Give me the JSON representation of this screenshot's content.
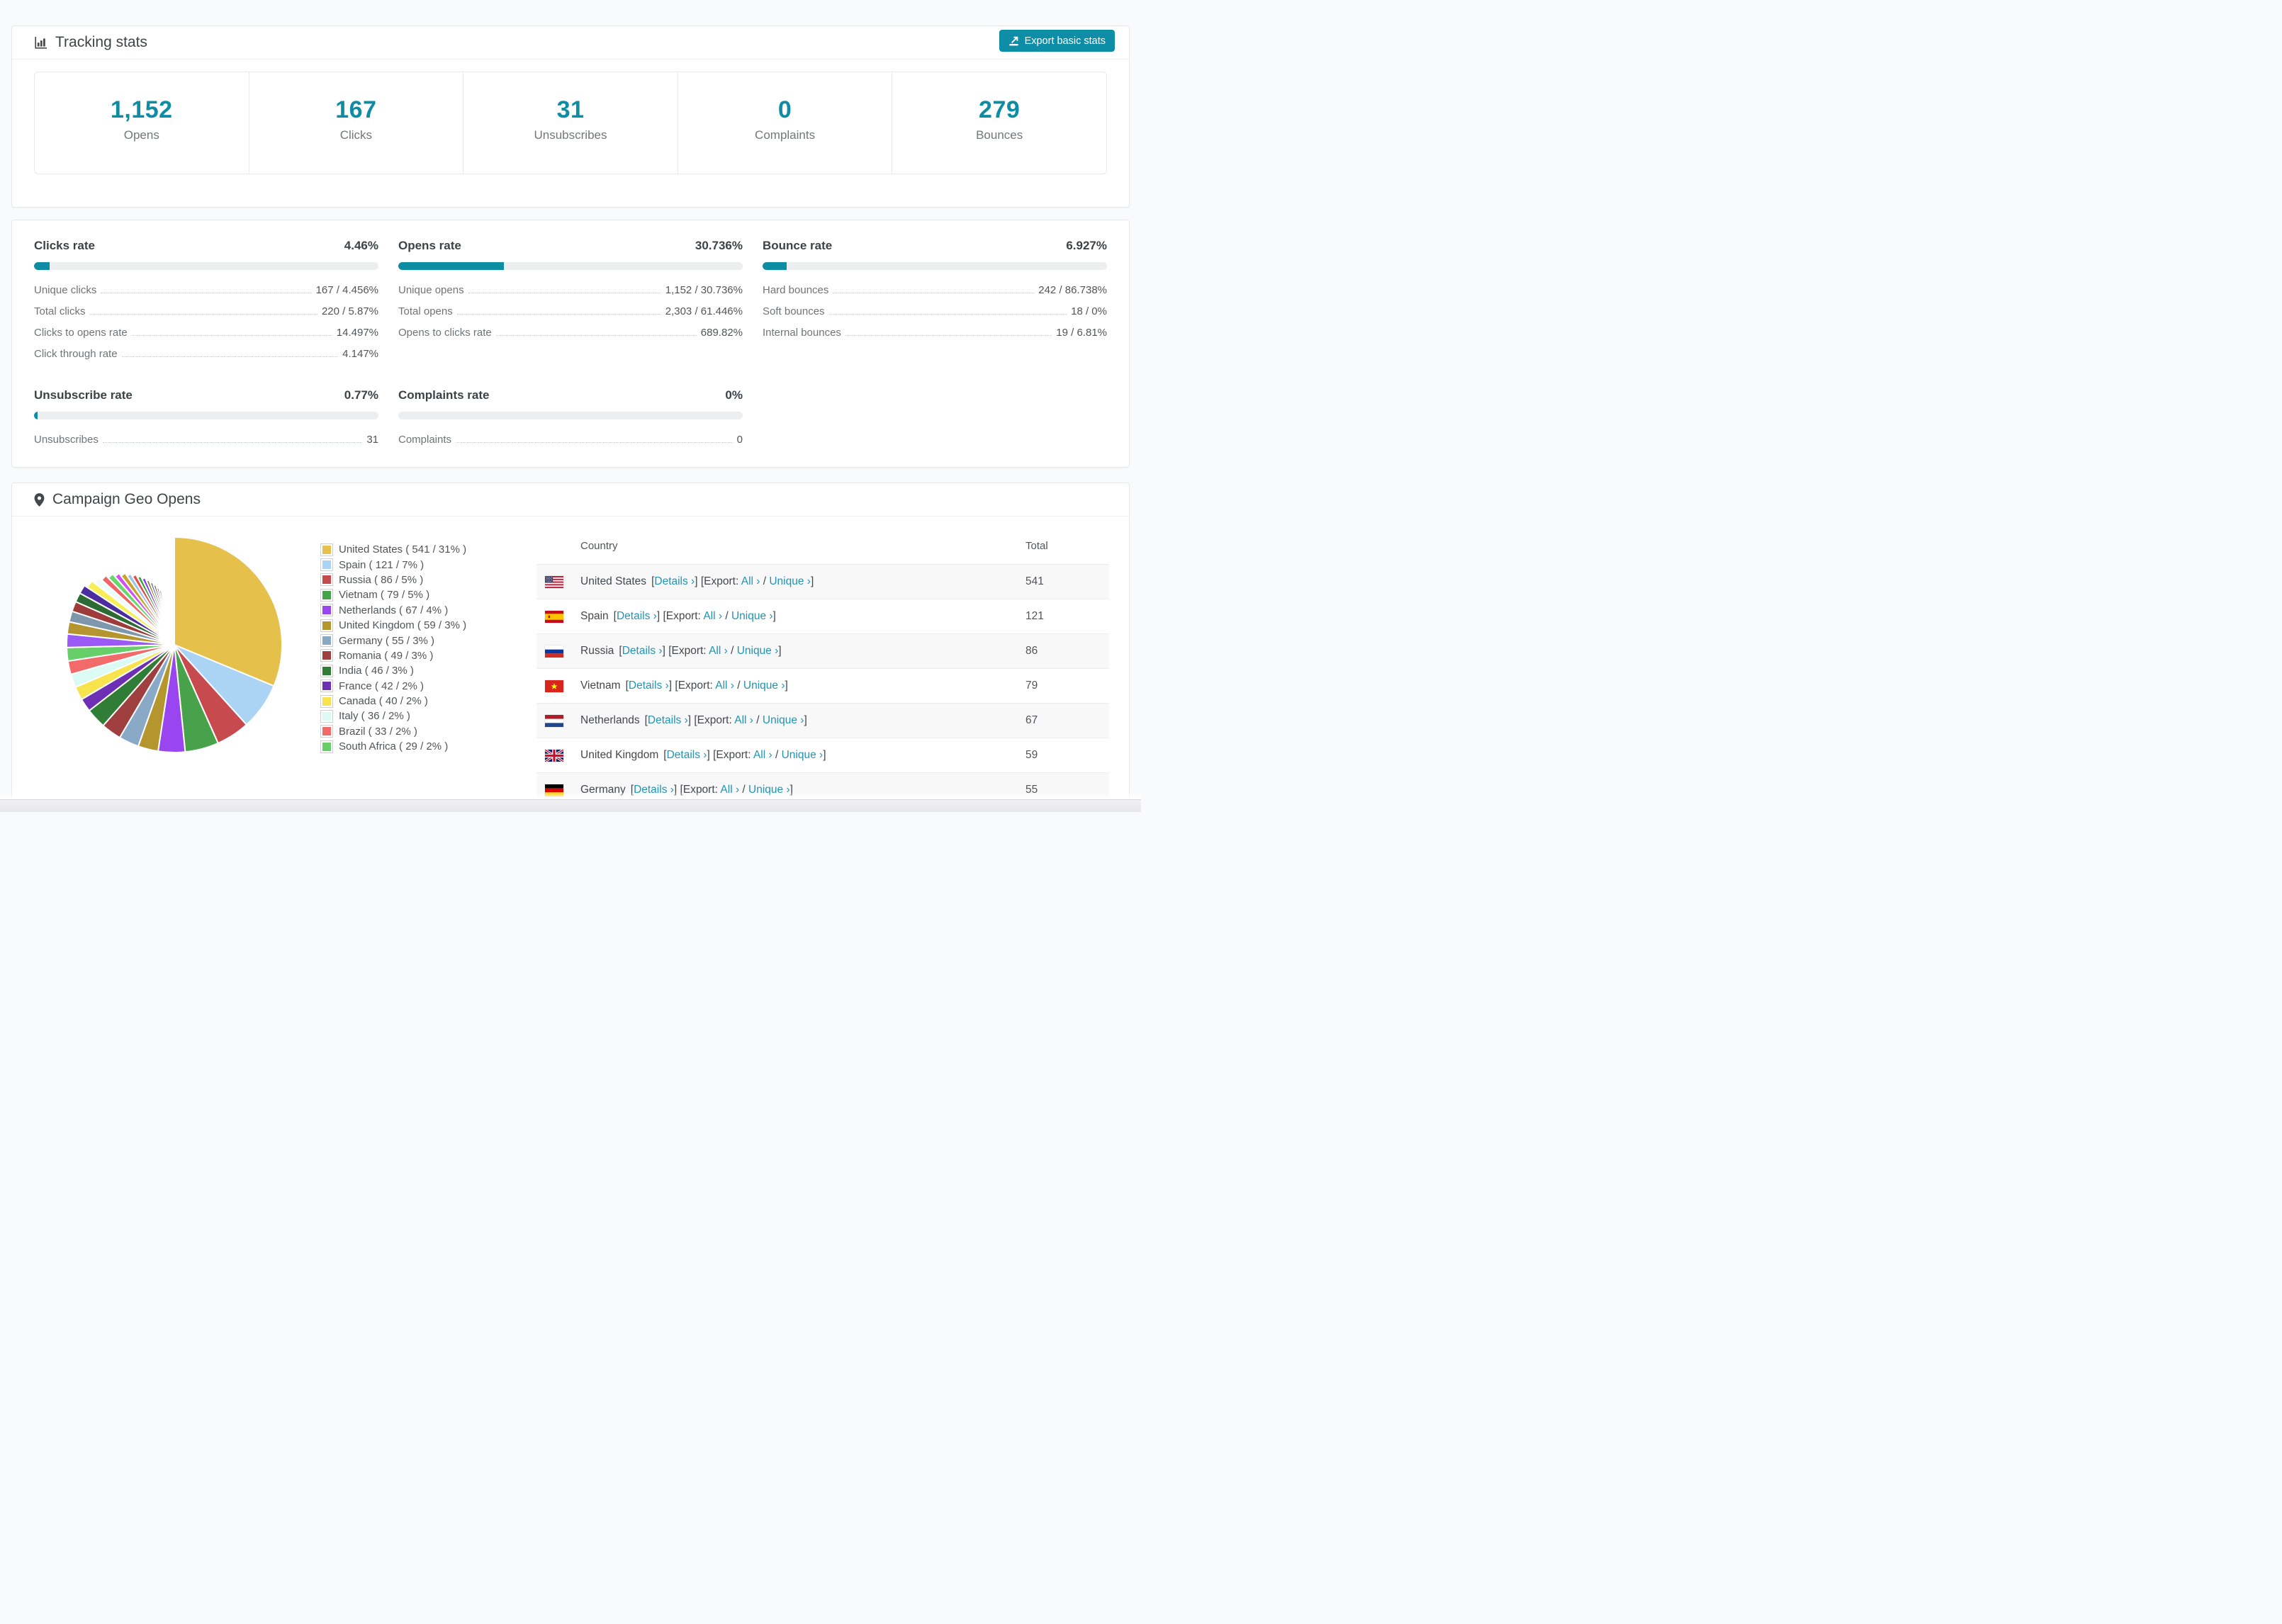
{
  "header": {
    "title": "Tracking stats",
    "export_label": "Export basic stats"
  },
  "summary": [
    {
      "value": "1,152",
      "label": "Opens"
    },
    {
      "value": "167",
      "label": "Clicks"
    },
    {
      "value": "31",
      "label": "Unsubscribes"
    },
    {
      "value": "0",
      "label": "Complaints"
    },
    {
      "value": "279",
      "label": "Bounces"
    }
  ],
  "rates": {
    "blocks": [
      {
        "title": "Clicks rate",
        "value": "4.46%",
        "percent": 4.46,
        "rows": [
          {
            "label": "Unique clicks",
            "value": "167 / 4.456%"
          },
          {
            "label": "Total clicks",
            "value": "220 / 5.87%"
          },
          {
            "label": "Clicks to opens rate",
            "value": "14.497%"
          },
          {
            "label": "Click through rate",
            "value": "4.147%"
          }
        ]
      },
      {
        "title": "Opens rate",
        "value": "30.736%",
        "percent": 30.736,
        "rows": [
          {
            "label": "Unique opens",
            "value": "1,152 / 30.736%"
          },
          {
            "label": "Total opens",
            "value": "2,303 / 61.446%"
          },
          {
            "label": "Opens to clicks rate",
            "value": "689.82%"
          }
        ]
      },
      {
        "title": "Bounce rate",
        "value": "6.927%",
        "percent": 6.927,
        "rows": [
          {
            "label": "Hard bounces",
            "value": "242 / 86.738%"
          },
          {
            "label": "Soft bounces",
            "value": "18 / 0%"
          },
          {
            "label": "Internal bounces",
            "value": "19 / 6.81%"
          }
        ]
      },
      {
        "title": "Unsubscribe rate",
        "value": "0.77%",
        "percent": 0.77,
        "rows": [
          {
            "label": "Unsubscribes",
            "value": "31"
          }
        ]
      },
      {
        "title": "Complaints rate",
        "value": "0%",
        "percent": 0,
        "rows": [
          {
            "label": "Complaints",
            "value": "0"
          }
        ]
      }
    ]
  },
  "geo": {
    "title": "Campaign Geo Opens",
    "table": {
      "columns": [
        "Country",
        "Total"
      ],
      "details_label": "Details ›",
      "export_prefix": "[Export: ",
      "all_label": "All ›",
      "unique_label": "Unique ›"
    },
    "rows": [
      {
        "country": "United States",
        "flag": "us",
        "total": "541"
      },
      {
        "country": "Spain",
        "flag": "es",
        "total": "121"
      },
      {
        "country": "Russia",
        "flag": "ru",
        "total": "86"
      },
      {
        "country": "Vietnam",
        "flag": "vn",
        "total": "79"
      },
      {
        "country": "Netherlands",
        "flag": "nl",
        "total": "67"
      },
      {
        "country": "United Kingdom",
        "flag": "gb",
        "total": "59"
      },
      {
        "country": "Germany",
        "flag": "de",
        "total": "55"
      }
    ]
  },
  "chart_data": {
    "type": "pie",
    "title": "Campaign Geo Opens",
    "unit": "opens",
    "legend_position": "right",
    "categories": [
      "United States",
      "Spain",
      "Russia",
      "Vietnam",
      "Netherlands",
      "United Kingdom",
      "Germany",
      "Romania",
      "India",
      "France",
      "Canada",
      "Italy",
      "Brazil",
      "South Africa"
    ],
    "values": [
      541,
      121,
      86,
      79,
      67,
      59,
      55,
      49,
      46,
      42,
      40,
      36,
      33,
      29
    ],
    "percents": [
      31,
      7,
      5,
      5,
      4,
      3,
      3,
      3,
      3,
      2,
      2,
      2,
      2,
      2
    ],
    "colors": [
      "#e5c04a",
      "#abd3f3",
      "#c74a4e",
      "#47a24b",
      "#9a46f0",
      "#b4952e",
      "#8aa9c7",
      "#a03f3f",
      "#2f7d36",
      "#6d2fb4",
      "#f7e34d",
      "#dcfaf4",
      "#f26a6a",
      "#66cf69"
    ],
    "other_unlabeled_tail": {
      "note": "many small unlabeled country slices, ~26% combined",
      "values": [
        2.0,
        1.8,
        1.6,
        1.5,
        1.4,
        1.3,
        1.2,
        1.1,
        1.0,
        1.0,
        0.9,
        0.9,
        0.8,
        0.8,
        0.7,
        0.7,
        0.6,
        0.6,
        0.55,
        0.5,
        0.5,
        0.45,
        0.4,
        0.4,
        0.35,
        0.35,
        0.3,
        0.3,
        0.25,
        0.25,
        0.2,
        0.2,
        0.15,
        0.15
      ],
      "colors": [
        "#9b59f6",
        "#b5952f",
        "#7e97ad",
        "#9e3c3c",
        "#2d6b35",
        "#4b2da0",
        "#f7ee55",
        "#eefcfa",
        "#f26363",
        "#66d96a",
        "#d24ff0",
        "#c9a227",
        "#9fc3e8",
        "#e04b4b",
        "#3f9a44",
        "#7b3ff2",
        "#8a7722",
        "#5a7187",
        "#7c2f2f",
        "#1e4d24",
        "#2a1f66",
        "#f3ef4e",
        "#fdfefe",
        "#fa6a6a",
        "#59e05e",
        "#e355f2",
        "#d4af37",
        "#aacdee",
        "#e25252",
        "#3da443",
        "#6a3df0",
        "#97822a",
        "#64809c",
        "#8a3434"
      ]
    }
  },
  "colors": {
    "accent_teal": "#0d8ca4",
    "link_teal": "#2095b3",
    "stat_number": "#0e8ca4",
    "bar_track": "#eceef0"
  }
}
